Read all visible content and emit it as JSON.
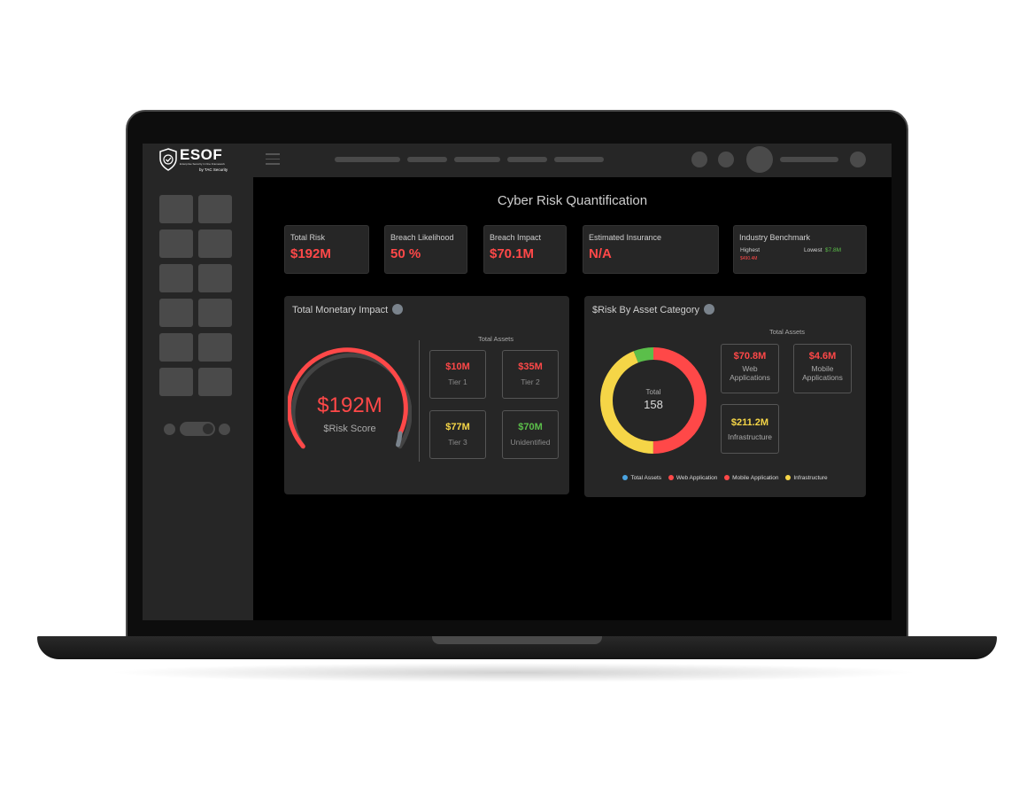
{
  "colors": {
    "risk_red": "#ff4848",
    "gain_green": "#5bbf4a",
    "warn_yellow": "#f5d547",
    "info_blue": "#4aa3e0",
    "panel_bg": "#262626"
  },
  "brand": {
    "name": "ESOF",
    "tagline": "Enterprise Security in One Framework",
    "by": "by TAC Security",
    "icon": "shield-check-icon"
  },
  "page": {
    "title": "Cyber Risk Quantification"
  },
  "kpis": {
    "total_risk": {
      "label": "Total Risk",
      "value": "$192M"
    },
    "breach_likelihood": {
      "label": "Breach Likelihood",
      "value": "50 %"
    },
    "breach_impact": {
      "label": "Breach Impact",
      "value": "$70.1M"
    },
    "estimated_insurance": {
      "label": "Estimated Insurance",
      "value": "N/A"
    },
    "industry_benchmark": {
      "label": "Industry Benchmark",
      "highest_label": "Highest",
      "highest_value": "$490.4M",
      "lowest_label": "Lowest",
      "lowest_value": "$7.8M"
    }
  },
  "monetary": {
    "title": "Total Monetary Impact",
    "gauge": {
      "value": "$192M",
      "label": "$Risk Score"
    },
    "assets_heading": "Total Assets",
    "tiers": [
      {
        "value": "$10M",
        "label": "Tier 1",
        "color": "#ff4848"
      },
      {
        "value": "$35M",
        "label": "Tier 2",
        "color": "#ff4848"
      },
      {
        "value": "$77M",
        "label": "Tier 3",
        "color": "#f5d547"
      },
      {
        "value": "$70M",
        "label": "Unidentified",
        "color": "#5bbf4a"
      }
    ]
  },
  "asset_category": {
    "title": "$Risk By Asset Category",
    "assets_heading": "Total Assets",
    "donut": {
      "center_label": "Total",
      "center_value": "158"
    },
    "boxes": {
      "web": {
        "value": "$70.8M",
        "label": "Web Applications"
      },
      "mobile": {
        "value": "$4.6M",
        "label": "Mobile Applications"
      },
      "infra": {
        "value": "$211.2M",
        "label": "Infrastructure"
      }
    },
    "legend": [
      {
        "label": "Total Assets",
        "color": "#4aa3e0"
      },
      {
        "label": "Web Application",
        "color": "#ff4848"
      },
      {
        "label": "Mobile Application",
        "color": "#ff4848"
      },
      {
        "label": "Infrastructure",
        "color": "#f5d547"
      }
    ]
  }
}
